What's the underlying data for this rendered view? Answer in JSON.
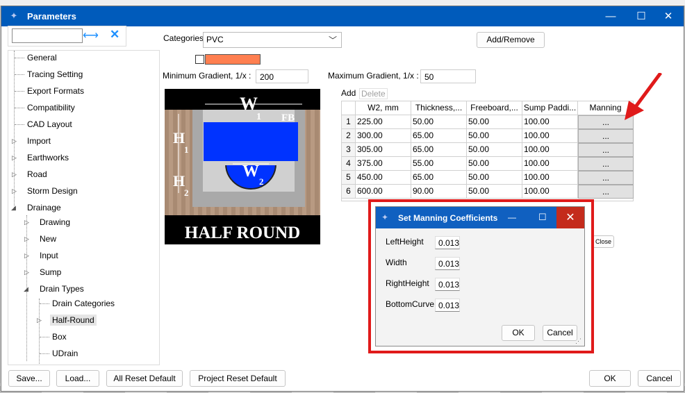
{
  "window": {
    "title": "Parameters",
    "minimize_glyph": "—",
    "maximize_glyph": "☐",
    "close_glyph": "✕"
  },
  "sidebar": {
    "search_value": "",
    "items": [
      {
        "label": "General"
      },
      {
        "label": "Tracing Setting"
      },
      {
        "label": "Export Formats"
      },
      {
        "label": "Compatibility"
      },
      {
        "label": "CAD Layout"
      },
      {
        "label": "Import"
      },
      {
        "label": "Earthworks"
      },
      {
        "label": "Road"
      },
      {
        "label": "Storm Design"
      },
      {
        "label": "Drainage"
      },
      {
        "label": "Drawing"
      },
      {
        "label": "New"
      },
      {
        "label": "Input"
      },
      {
        "label": "Sump"
      },
      {
        "label": "Drain Types"
      },
      {
        "label": "Drain Categories"
      },
      {
        "label": "Half-Round"
      },
      {
        "label": "Box"
      },
      {
        "label": "UDrain"
      }
    ]
  },
  "form": {
    "categories_label": "Categories",
    "categories_value": "PVC",
    "add_remove_label": "Add/Remove",
    "min_gradient_label": "Minimum Gradient, 1/x :",
    "min_gradient_value": "200",
    "max_gradient_label": "Maximum Gradient, 1/x :",
    "max_gradient_value": "50",
    "add_label": "Add",
    "delete_label": "Delete",
    "swatch_color": "#ff7f50"
  },
  "picture": {
    "w1_label": "W",
    "w1_sub": "1",
    "fb_label": "FB",
    "h1_label": "H",
    "h1_sub": "1",
    "h2_label": "H",
    "h2_sub": "2",
    "w2_label": "W",
    "w2_sub": "2",
    "caption": "HALF ROUND"
  },
  "grid": {
    "columns": [
      "W2, mm",
      "Thickness,...",
      "Freeboard,...",
      "Sump Paddi...",
      "Manning"
    ],
    "rows": [
      {
        "n": "1",
        "w2": "225.00",
        "thickness": "50.00",
        "freeboard": "50.00",
        "sump": "100.00",
        "manning": "..."
      },
      {
        "n": "2",
        "w2": "300.00",
        "thickness": "65.00",
        "freeboard": "50.00",
        "sump": "100.00",
        "manning": "..."
      },
      {
        "n": "3",
        "w2": "305.00",
        "thickness": "65.00",
        "freeboard": "50.00",
        "sump": "100.00",
        "manning": "..."
      },
      {
        "n": "4",
        "w2": "375.00",
        "thickness": "55.00",
        "freeboard": "50.00",
        "sump": "100.00",
        "manning": "..."
      },
      {
        "n": "5",
        "w2": "450.00",
        "thickness": "65.00",
        "freeboard": "50.00",
        "sump": "100.00",
        "manning": "..."
      },
      {
        "n": "6",
        "w2": "600.00",
        "thickness": "90.00",
        "freeboard": "50.00",
        "sump": "100.00",
        "manning": "..."
      }
    ]
  },
  "behind_close_label": "Close",
  "dialog": {
    "title": "Set Manning Coefficients",
    "fields": [
      {
        "label": "LeftHeight",
        "value": "0.013"
      },
      {
        "label": "Width",
        "value": "0.013"
      },
      {
        "label": "RightHeight",
        "value": "0.013"
      },
      {
        "label": "BottomCurve",
        "value": "0.013"
      }
    ],
    "ok_label": "OK",
    "cancel_label": "Cancel",
    "highlight_color": "#e01a1a"
  },
  "footer": {
    "save_label": "Save...",
    "load_label": "Load...",
    "all_reset_label": "All Reset Default",
    "project_reset_label": "Project Reset Default",
    "ok_label": "OK",
    "cancel_label": "Cancel"
  }
}
